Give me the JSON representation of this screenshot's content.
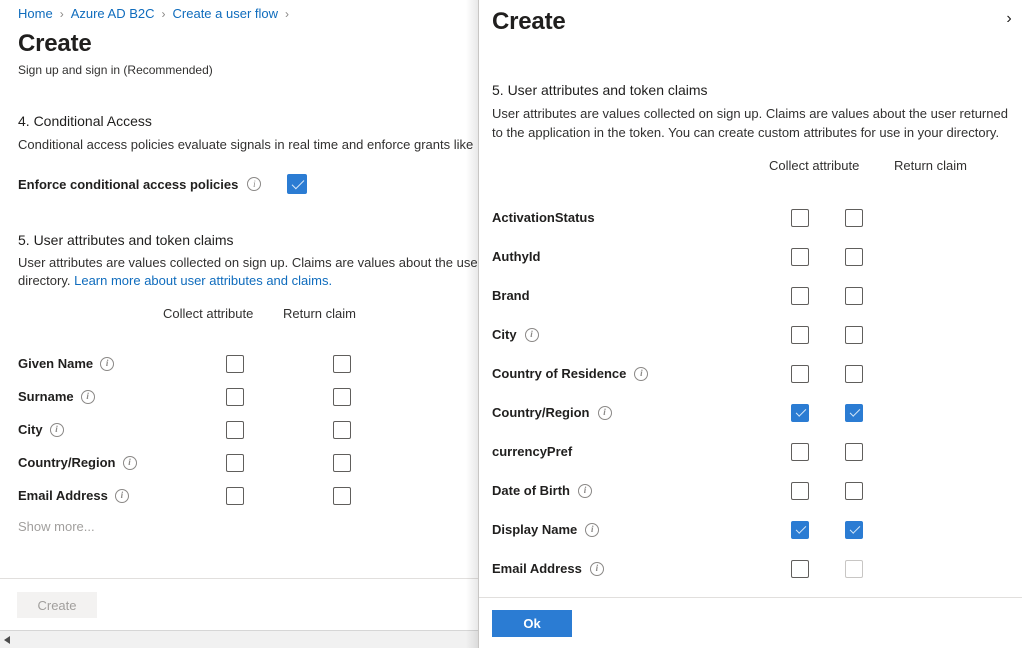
{
  "breadcrumb": {
    "items": [
      {
        "label": "Home"
      },
      {
        "label": "Azure AD B2C"
      },
      {
        "label": "Create a user flow"
      }
    ],
    "separator": "›"
  },
  "left_blade": {
    "title": "Create",
    "subtitle": "Sign up and sign in (Recommended)",
    "section4": {
      "heading": "4. Conditional Access",
      "description": "Conditional access policies evaluate signals in real time and enforce grants like",
      "enforce_label": "Enforce conditional access policies",
      "enforce_info_icon": "info-icon",
      "enforce_checked": true
    },
    "section5": {
      "heading": "5. User attributes and token claims",
      "description_line1": "User attributes are values collected on sign up. Claims are values about the user",
      "description_line2_prefix": "directory. ",
      "description_link": "Learn more about user attributes and claims.",
      "columns": {
        "collect": "Collect attribute",
        "return": "Return claim"
      },
      "attributes": [
        {
          "name": "Given Name",
          "info": true,
          "collect": false,
          "return": false
        },
        {
          "name": "Surname",
          "info": true,
          "collect": false,
          "return": false
        },
        {
          "name": "City",
          "info": true,
          "collect": false,
          "return": false
        },
        {
          "name": "Country/Region",
          "info": true,
          "collect": false,
          "return": false
        },
        {
          "name": "Email Address",
          "info": true,
          "collect": false,
          "return": false
        }
      ],
      "show_more": "Show more..."
    },
    "create_button": "Create",
    "create_button_disabled": true
  },
  "right_panel": {
    "title": "Create",
    "close_icon": "chevron-right-close-icon",
    "section": {
      "heading": "5. User attributes and token claims",
      "description": "User attributes are values collected on sign up. Claims are values about the user returned to the application in the token. You can create custom attributes for use in your directory."
    },
    "columns": {
      "collect": "Collect attribute",
      "return": "Return claim"
    },
    "attributes": [
      {
        "name": "ActivationStatus",
        "info": false,
        "collect": false,
        "return": false,
        "return_disabled": false
      },
      {
        "name": "AuthyId",
        "info": false,
        "collect": false,
        "return": false,
        "return_disabled": false
      },
      {
        "name": "Brand",
        "info": false,
        "collect": false,
        "return": false,
        "return_disabled": false
      },
      {
        "name": "City",
        "info": true,
        "collect": false,
        "return": false,
        "return_disabled": false
      },
      {
        "name": "Country of Residence",
        "info": true,
        "collect": false,
        "return": false,
        "return_disabled": false
      },
      {
        "name": "Country/Region",
        "info": true,
        "collect": true,
        "return": true,
        "return_disabled": false
      },
      {
        "name": "currencyPref",
        "info": false,
        "collect": false,
        "return": false,
        "return_disabled": false
      },
      {
        "name": "Date of Birth",
        "info": true,
        "collect": false,
        "return": false,
        "return_disabled": false
      },
      {
        "name": "Display Name",
        "info": true,
        "collect": true,
        "return": true,
        "return_disabled": false
      },
      {
        "name": "Email Address",
        "info": true,
        "collect": false,
        "return": false,
        "return_disabled": true
      }
    ],
    "ok_button": "Ok"
  },
  "colors": {
    "accent": "#2b7cd3",
    "link": "#0f6cbd",
    "text": "#323130",
    "disabled_text": "#a19f9d",
    "border": "#c8c6c4"
  }
}
